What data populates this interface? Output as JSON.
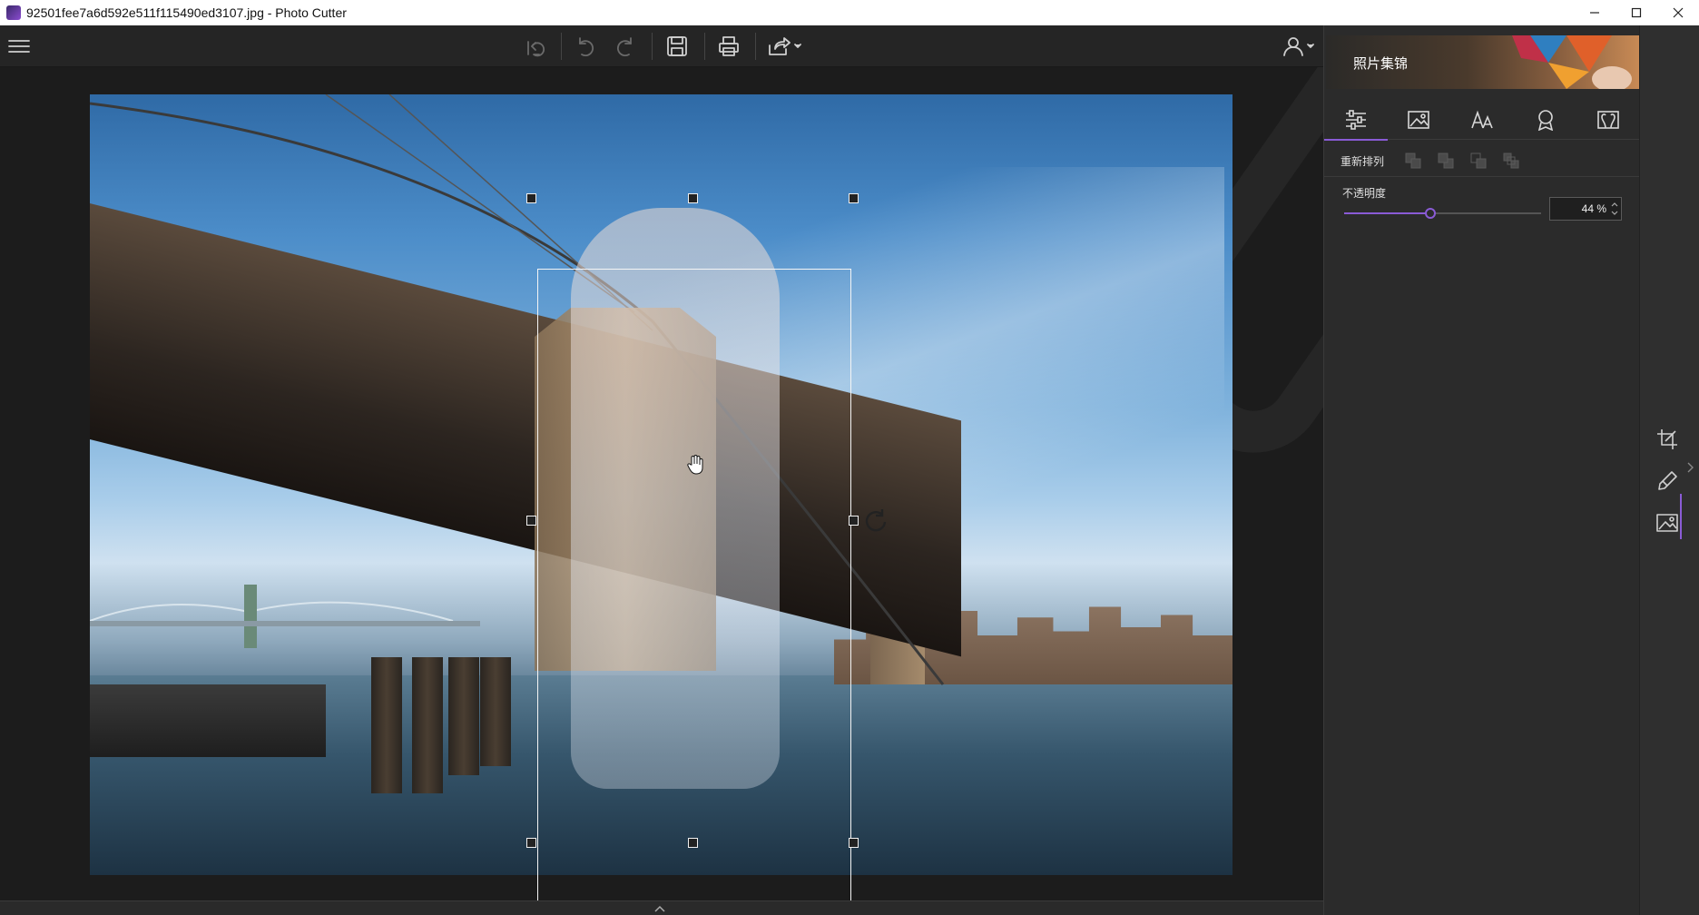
{
  "window": {
    "title": "92501fee7a6d592e511f115490ed3107.jpg - Photo Cutter",
    "icons": {
      "minimize": "minimize-icon",
      "maximize": "maximize-icon",
      "close": "close-icon"
    }
  },
  "toolbar": {
    "icons": [
      "menu-icon",
      "undo-all-icon",
      "undo-icon",
      "redo-icon",
      "save-icon",
      "print-icon",
      "share-icon",
      "user-icon"
    ]
  },
  "panel": {
    "banner_text": "照片集锦",
    "tabs": [
      "adjust-icon",
      "image-icon",
      "text-icon",
      "sticker-icon",
      "frame-icon"
    ],
    "active_tab": 0,
    "arrange_label": "重新排列",
    "opacity_label": "不透明度",
    "opacity_percent": 44,
    "opacity_value": "44 %"
  },
  "rail": {
    "icons": [
      "crop-icon",
      "brush-icon",
      "background-icon"
    ],
    "active": "background-icon"
  },
  "colors": {
    "accent": "#8a5bd6",
    "panel": "#2b2b2b",
    "canvas": "#1c1c1c"
  }
}
